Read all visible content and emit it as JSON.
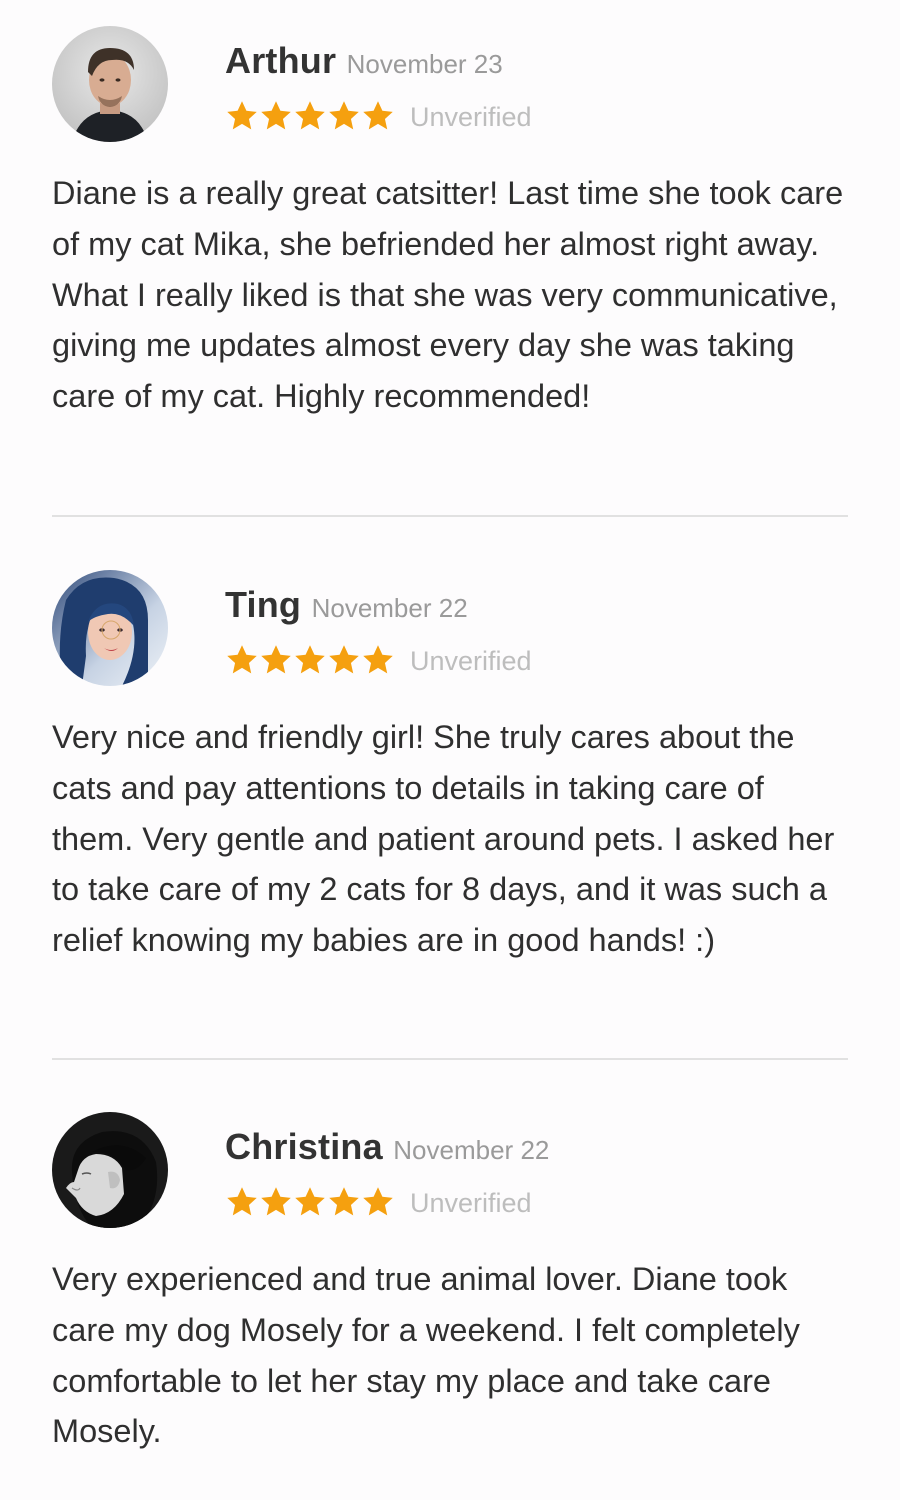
{
  "reviews": [
    {
      "name": "Arthur",
      "date": "November 23",
      "rating": 5,
      "verification": "Unverified",
      "avatar_icon": "avatar-photo-man",
      "text": "Diane is a really great catsitter! Last time she took care of my cat Mika, she befriended her almost right away. What I really liked is that she was very communicative, giving me updates almost every day she was taking care of my cat. Highly recommended!"
    },
    {
      "name": "Ting",
      "date": "November 22",
      "rating": 5,
      "verification": "Unverified",
      "avatar_icon": "avatar-photo-woman-blue-hair",
      "text": "Very nice and friendly girl! She truly cares about the cats and pay attentions to details in taking care of them. Very gentle and patient around pets. I asked her to take care of my 2 cats for 8 days, and it was such a relief knowing my babies are in good hands! :)"
    },
    {
      "name": "Christina",
      "date": "November 22",
      "rating": 5,
      "verification": "Unverified",
      "avatar_icon": "avatar-photo-woman-profile-bw",
      "text": "Very experienced and true animal lover. Diane took care my dog Mosely for a weekend. I felt completely comfortable to let her stay my place and take care Mosely."
    }
  ],
  "colors": {
    "star": "#f5a00f",
    "name": "#333333",
    "date": "#9a9a9a",
    "verification": "#bdbdbd",
    "divider": "#e1e1e1"
  }
}
